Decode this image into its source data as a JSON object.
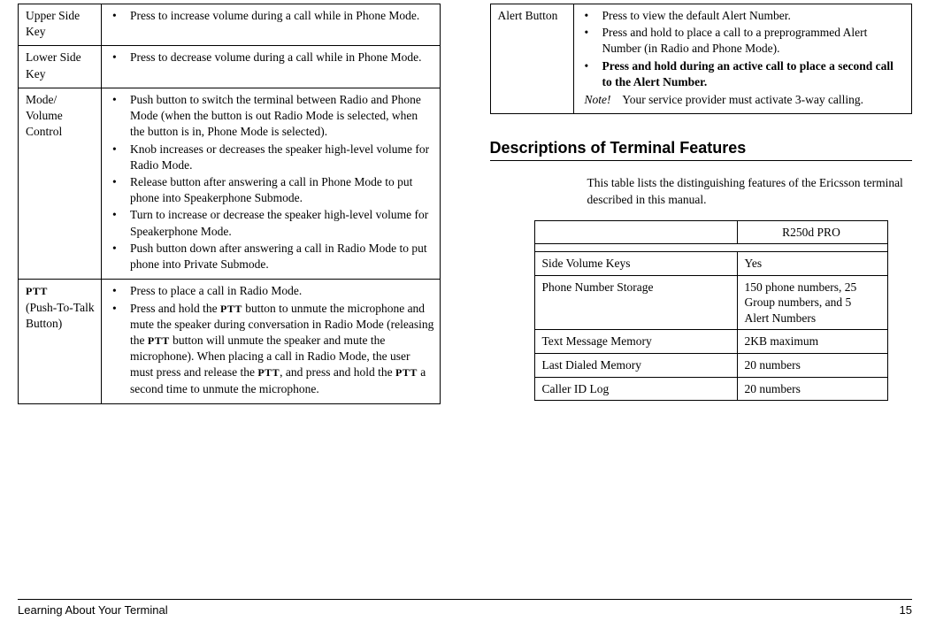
{
  "left_table": [
    {
      "label": "Upper Side Key",
      "bullets": [
        "Press to increase volume during a call while in Phone Mode."
      ]
    },
    {
      "label": "Lower Side Key",
      "bullets": [
        "Press to decrease volume during a call while in Phone Mode."
      ]
    },
    {
      "label": "Mode/\nVolume Control",
      "bullets": [
        "Push button to switch the terminal between Radio and Phone Mode (when the button is out Radio Mode is selected, when the button is in, Phone Mode is selected).",
        "Knob increases or decreases the speaker high-level volume for Radio Mode.",
        "Release button after answering a call in Phone Mode to put phone into Speakerphone Submode.",
        "Turn to increase or decrease the speaker high-level volume for Speakerphone Mode.",
        "Push button down after answering a call in Radio Mode to put phone into Private Submode."
      ]
    },
    {
      "label_html": "<span class='ptt-small'>PTT</span><br>(Push-To-Talk Button)",
      "bullets_html": [
        "Press to place a call in Radio Mode.",
        "Press and hold the <span class='ptt-small'>PTT</span> button to unmute the micro­phone and mute the speaker during conversation in Radio Mode (releasing the <span class='ptt-small'>PTT</span> button will unmute the speaker and mute the microphone). When plac­ing a call in Radio Mode, the user must press and release the <span class='ptt-small'>PTT</span>, and press and hold the <span class='ptt-small'>PTT</span> a second time to unmute the microphone."
      ]
    }
  ],
  "right_table": [
    {
      "label": "Alert Button",
      "bullets_html": [
        "Press to view the default Alert Number.",
        "Press and hold to place a call to a preprogrammed Alert Number (in Radio and Phone Mode).",
        "<span class='bold'>Press and hold during an active call to place a sec­ond call to the Alert Number.</span>"
      ],
      "note": "Your service provider must activate 3-way calling."
    }
  ],
  "section_title": "Descriptions of Terminal Features",
  "section_intro": "This table lists the distinguishing features of the Ericsson terminal described in this manual.",
  "features": {
    "model": "R250d PRO",
    "rows": [
      {
        "name": "Side Volume Keys",
        "value": "Yes"
      },
      {
        "name": "Phone Number Storage",
        "value": "150 phone numbers, 25 Group numbers, and 5 Alert Numbers"
      },
      {
        "name": "Text Message Memory",
        "value": "2KB maximum"
      },
      {
        "name": "Last Dialed Memory",
        "value": "20 numbers"
      },
      {
        "name": "Caller ID Log",
        "value": "20 numbers"
      }
    ]
  },
  "footer": {
    "left": "Learning About Your Terminal",
    "right": "15"
  }
}
